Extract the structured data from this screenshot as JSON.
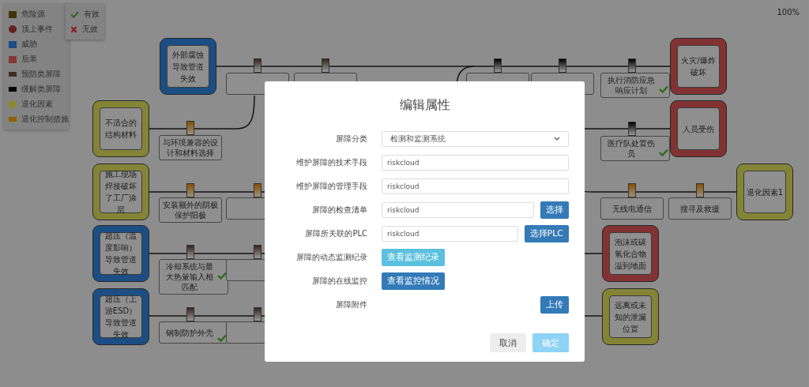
{
  "legend": [
    {
      "kind": "hazard",
      "label": "危险源"
    },
    {
      "kind": "top-event",
      "label": "顶上事件"
    },
    {
      "kind": "threat",
      "label": "威胁"
    },
    {
      "kind": "consequence",
      "label": "后果"
    },
    {
      "kind": "prevention",
      "label": "预防类屏障"
    },
    {
      "kind": "mitigation",
      "label": "缓解类屏障"
    },
    {
      "kind": "degradation",
      "label": "退化因素"
    },
    {
      "kind": "degradation-control",
      "label": "退化控制措施"
    }
  ],
  "status_legend": [
    {
      "kind": "effective",
      "label": "有效"
    },
    {
      "kind": "ineffective",
      "label": "无效"
    }
  ],
  "zoom": "100%",
  "diagram": {
    "nodes": [
      {
        "kind": "threat",
        "text": "外部腐蚀导致管道失效"
      },
      {
        "kind": "degradation",
        "text": "不适合的结构材料"
      },
      {
        "kind": "degradation",
        "text": "施工现场焊接破坏了工厂涂层"
      },
      {
        "kind": "threat",
        "text": "超压（温度影响）导致管道失效"
      },
      {
        "kind": "threat",
        "text": "超压（上游ESD）导致管道失效"
      },
      {
        "kind": "consequence",
        "text": "火灾/爆炸破坏"
      },
      {
        "kind": "consequence",
        "text": "人员受伤"
      },
      {
        "kind": "degradation",
        "text": "退化因素1"
      },
      {
        "kind": "consequence",
        "text": "泡沫或碳氢化合物溢到地面"
      },
      {
        "kind": "degradation",
        "text": "远离或未知的泄漏位置"
      }
    ],
    "barriers": [
      {
        "kind": "prevention",
        "effective": false
      },
      {
        "kind": "prevention",
        "effective": false
      },
      {
        "kind": "degradation-control",
        "text": "与环境兼容的设计和材料选择",
        "effective": false
      },
      {
        "kind": "degradation-control",
        "text": "安装额外的阴极保护阳极",
        "effective": false
      },
      {
        "kind": "degradation-control",
        "effective": false
      },
      {
        "kind": "prevention",
        "text": "冷却系统与最大热量输入相匹配",
        "effective": true
      },
      {
        "kind": "prevention",
        "effective": false
      },
      {
        "kind": "prevention",
        "text": "钢制防护外壳",
        "effective": true
      },
      {
        "kind": "prevention",
        "effective": false
      },
      {
        "kind": "mitigation",
        "effective": false
      },
      {
        "kind": "mitigation",
        "effective": false
      },
      {
        "kind": "mitigation",
        "text": "执行消防应急响应计划",
        "effective": true
      },
      {
        "kind": "mitigation",
        "text": "医疗队处置伤员",
        "effective": true
      },
      {
        "kind": "degradation-control",
        "text": "无线电通信",
        "effective": false
      },
      {
        "kind": "degradation-control",
        "text": "搜寻及救援",
        "effective": false
      }
    ]
  },
  "dialog": {
    "title": "编辑属性",
    "rows": [
      {
        "kind": "select",
        "label": "屏障分类",
        "value": "检测和监测系统"
      },
      {
        "kind": "text",
        "label": "维护屏障的技术手段",
        "value": "riskcloud"
      },
      {
        "kind": "text",
        "label": "维护屏障的管理手段",
        "value": "riskcloud"
      },
      {
        "kind": "text-button",
        "label": "屏障的检查清单",
        "value": "riskcloud",
        "button": "选择"
      },
      {
        "kind": "text-button",
        "label": "屏障所关联的PLC",
        "value": "riskcloud",
        "button": "选择PLC"
      },
      {
        "kind": "record-button",
        "label": "屏障的动态监测纪录",
        "button": "查看监测纪录"
      },
      {
        "kind": "live-button",
        "label": "屏障的在线监控",
        "button": "查看监控情况"
      },
      {
        "kind": "upload",
        "label": "屏障附件",
        "button": "上传"
      }
    ],
    "footer": [
      {
        "kind": "cancel",
        "label": "取消",
        "disabled": false
      },
      {
        "kind": "confirm",
        "label": "确定",
        "disabled": true
      }
    ]
  }
}
